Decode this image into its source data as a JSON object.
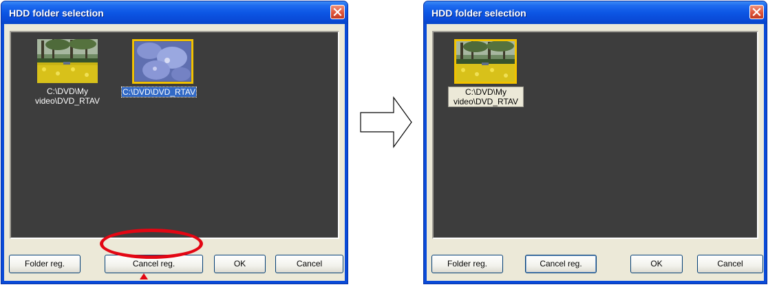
{
  "left_dialog": {
    "title": "HDD folder selection",
    "items": [
      {
        "caption_line1": "C:\\DVD\\My",
        "caption_line2": "video\\DVD_RTAV",
        "thumbnail": "flower-field-photo",
        "selected": false
      },
      {
        "caption": "C:\\DVD\\DVD_RTAV",
        "thumbnail": "purple-flower-photo",
        "selected": true
      }
    ],
    "buttons": {
      "folder_reg": "Folder reg.",
      "cancel_reg": "Cancel reg.",
      "ok": "OK",
      "cancel": "Cancel"
    }
  },
  "right_dialog": {
    "title": "HDD folder selection",
    "items": [
      {
        "caption_line1": "C:\\DVD\\My",
        "caption_line2": "video\\DVD_RTAV",
        "thumbnail": "flower-field-photo",
        "selected": true
      }
    ],
    "buttons": {
      "folder_reg": "Folder reg.",
      "cancel_reg": "Cancel reg.",
      "ok": "OK",
      "cancel": "Cancel"
    }
  },
  "annotation": {
    "highlight_color": "#e30613",
    "target": "cancel-reg-button",
    "transition_icon": "right-arrow-icon"
  },
  "colors": {
    "title_bar": "#0a4bd8",
    "panel_bg": "#3d3d3d",
    "selection_border": "#f2c200",
    "selected_caption_bg": "#3169c6"
  }
}
